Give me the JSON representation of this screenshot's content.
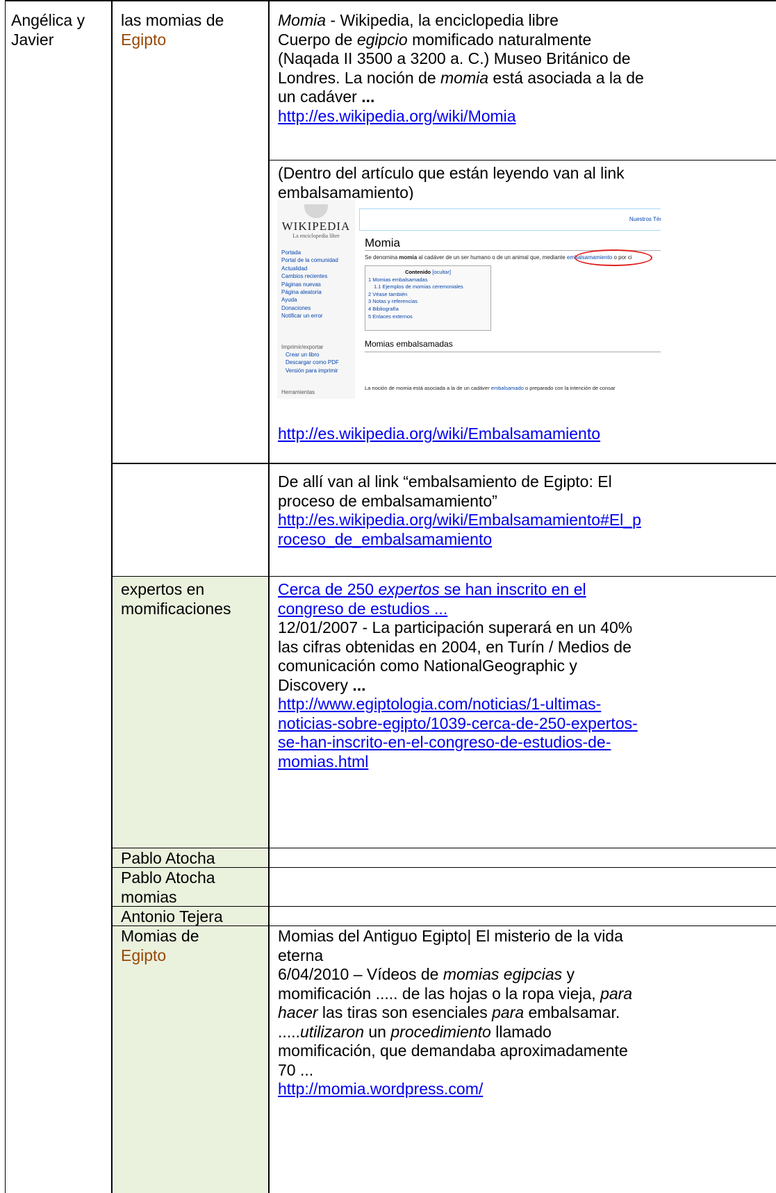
{
  "row1": {
    "col1": [
      "Angélica y",
      "Javier"
    ],
    "col2_line1": "las momias de",
    "col2_line2": "Egipto",
    "entry1": {
      "title_em": "Momia",
      "title_rest": " - Wikipedia, la enciclopedia libre",
      "l2a": "Cuerpo de ",
      "l2em": "egipcio",
      "l2b": " momificado naturalmente",
      "l3": "(Naqada II 3500 a 3200 a. C.) Museo Británico de",
      "l4a": "Londres. La noción de ",
      "l4em": "momia",
      "l4b": " está asociada a la de",
      "l5a": "un cadáver ",
      "l5b": "...",
      "url": "http://es.wikipedia.org/wiki/Momia"
    },
    "entry2": {
      "l1": "(Dentro del artículo que están leyendo van al link",
      "l2": "embalsamamiento)",
      "url": "http://es.wikipedia.org/wiki/Embalsamamiento"
    },
    "screenshot": {
      "logo_title": "WIKIPEDIA",
      "logo_sub": "La enciclopedia libre",
      "nav": [
        "Portada",
        "Portal de la comunidad",
        "Actualidad",
        "Cambios recientes",
        "Páginas nuevas",
        "Página aleatoria",
        "Ayuda",
        "Donaciones",
        "Notificar un error"
      ],
      "nav_section": "Imprimir/exportar",
      "nav_sub": [
        "Crear un libro",
        "Descargar como PDF",
        "Versión para imprimir"
      ],
      "tools": "Herramientas",
      "tab_text": "Nuestros Tér",
      "page_title": "Momia",
      "lead_a": "Se denomina ",
      "lead_b": "momia",
      "lead_c": " al cadáver de un ser humano o de un animal que, mediante ",
      "lead_link": "embalsamamiento",
      "lead_d": " o por ci",
      "toc_title": "Contenido",
      "toc_hide": "[ocultar]",
      "toc": [
        "1 Momias embalsamadas",
        "1.1 Ejemplos de momias ceremoniales",
        "2 Véase también",
        "3 Notas y referencias",
        "4 Bibliografía",
        "5 Enlaces externos"
      ],
      "h2": "Momias embalsamadas",
      "para_a": "La noción de momia está asociada a la de un cadáver ",
      "para_link": "embalsamado",
      "para_b": " o preparado con la intención de consar"
    }
  },
  "row2": {
    "l1": "De allí van al link “embalsamiento de Egipto: El",
    "l2": "proceso de embalsamamiento”",
    "url_l1": "http://es.wikipedia.org/wiki/Embalsamamiento#El_p",
    "url_l2": "roceso_de_embalsamamiento"
  },
  "row3": {
    "col2": [
      "expertos en",
      "momificaciones"
    ],
    "link_a": "Cerca de 250 ",
    "link_em": "expertos",
    "link_b": " se han inscrito en el",
    "link_l2": "congreso de estudios ...",
    "t1": "12/01/2007 - La participación superará en un 40%",
    "t2": "las cifras obtenidas en 2004, en Turín / Medios de",
    "t3": "comunicación como NationalGeographic y",
    "t4a": "Discovery ",
    "t4b": "...",
    "url": [
      "http://www.egiptologia.com/noticias/1-ultimas-",
      "noticias-sobre-egipto/1039-cerca-de-250-expertos-",
      "se-han-inscrito-en-el-congreso-de-estudios-de-",
      "momias.html"
    ]
  },
  "row4": {
    "col2": "Pablo Atocha"
  },
  "row5": {
    "col2": [
      "Pablo Atocha",
      "momias"
    ]
  },
  "row6": {
    "col2": "Antonio Tejera"
  },
  "row7": {
    "col2_line1": "Momias de",
    "col2_line2": "Egipto",
    "l1": "Momias del Antiguo Egipto| El misterio de la vida",
    "l2": "eterna",
    "l3a": "6/04/2010 – Vídeos de ",
    "l3em": "momias egipcias",
    "l3b": " y",
    "l4a": "momificación ..... de las hojas o la ropa vieja, ",
    "l4em": "para",
    "l5em": "hacer",
    "l5a": " las tiras son esenciales ",
    "l5em2": "para",
    "l5b": " embalsamar.",
    "l6a": ".....",
    "l6em": "utilizaron",
    "l6b": " un ",
    "l6em2": "procedimiento",
    "l6c": " llamado",
    "l7": "momificación, que demandaba aproximadamente",
    "l8": "70 ...",
    "url": "http://momia.wordpress.com/"
  }
}
